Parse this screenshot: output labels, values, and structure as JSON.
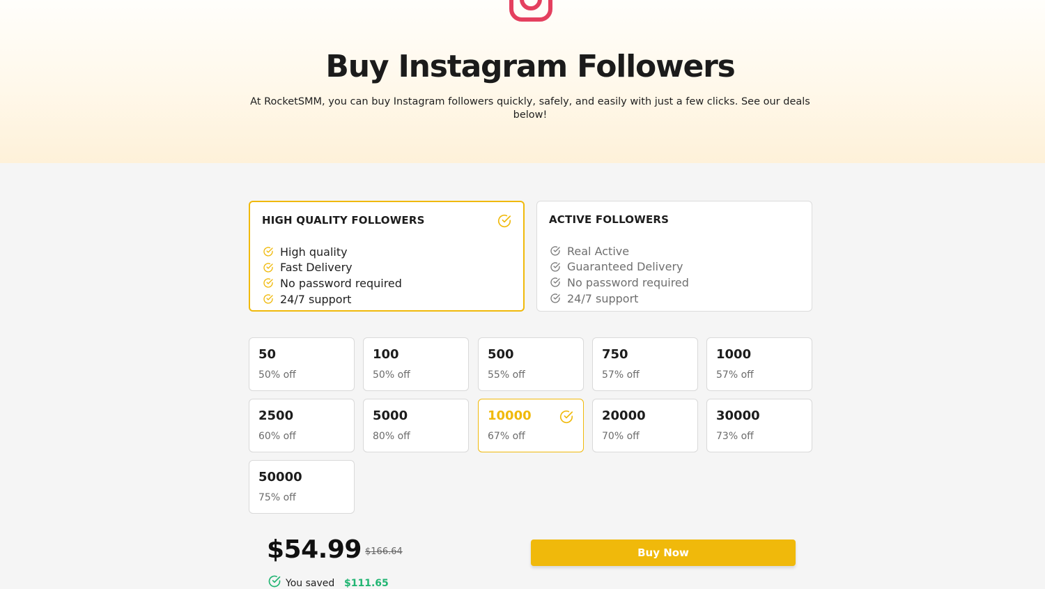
{
  "header": {
    "logo_icon": "instagram-icon",
    "title": "Buy Instagram Followers",
    "subtitle": "At RocketSMM, you can buy Instagram followers quickly, safely, and easily with just a few clicks. See our deals below!"
  },
  "colors": {
    "accent": "#f0b90b",
    "instagram": "#e4405f",
    "saved": "#22b573"
  },
  "follower_types": [
    {
      "title": "HIGH QUALITY FOLLOWERS",
      "selected": true,
      "features": [
        "High quality",
        "Fast Delivery",
        "No password required",
        "24/7 support"
      ]
    },
    {
      "title": "ACTIVE FOLLOWERS",
      "selected": false,
      "features": [
        "Real Active",
        "Guaranteed Delivery",
        "No password required",
        "24/7 support"
      ]
    }
  ],
  "packages": [
    {
      "qty": "50",
      "off": "50% off"
    },
    {
      "qty": "100",
      "off": "50% off"
    },
    {
      "qty": "500",
      "off": "55% off"
    },
    {
      "qty": "750",
      "off": "57% off"
    },
    {
      "qty": "1000",
      "off": "57% off"
    },
    {
      "qty": "2500",
      "off": "60% off"
    },
    {
      "qty": "5000",
      "off": "80% off"
    },
    {
      "qty": "10000",
      "off": "67% off",
      "selected": true
    },
    {
      "qty": "20000",
      "off": "70% off"
    },
    {
      "qty": "30000",
      "off": "73% off"
    },
    {
      "qty": "50000",
      "off": "75% off"
    }
  ],
  "checkout": {
    "price": "$54.99",
    "old_price": "$166.64",
    "saved_label": "You saved",
    "saved_amount": "$111.65",
    "buy_label": "Buy Now"
  }
}
